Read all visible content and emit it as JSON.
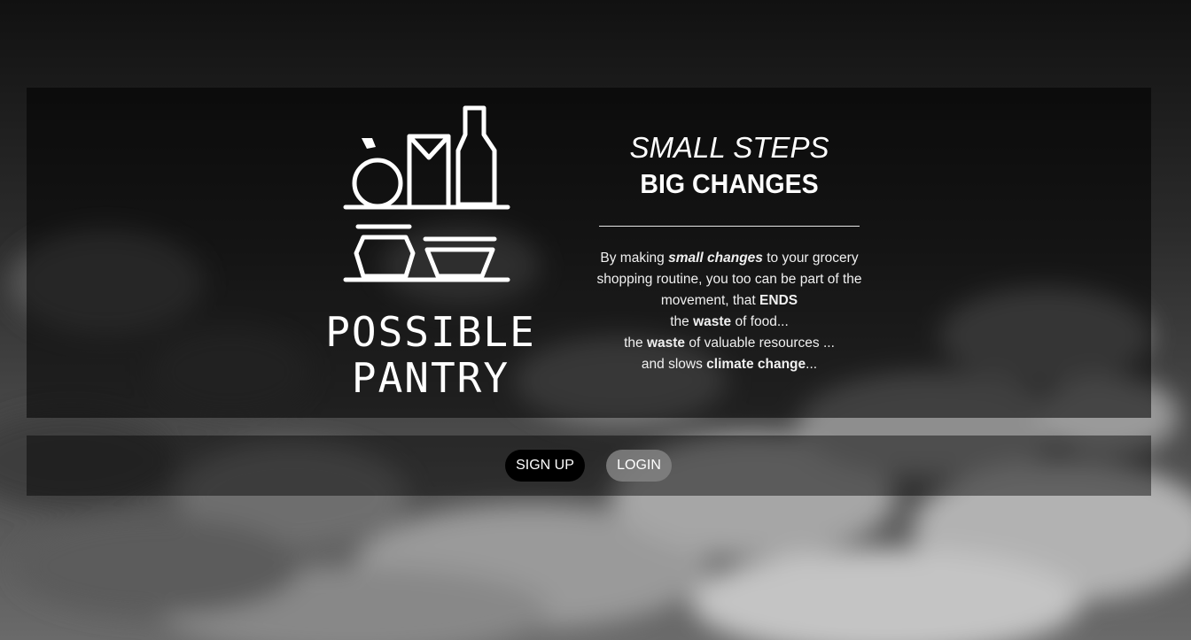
{
  "brand": {
    "line1": "POSSIBLE",
    "line2": "PANTRY",
    "logo_icon": "pantry-shelf-icon"
  },
  "tagline": {
    "line1": "SMALL STEPS",
    "line2": "BIG CHANGES"
  },
  "description": {
    "p1_pre": "By making ",
    "p1_em": "small changes",
    "p1_post": " to your grocery shopping routine, you too can be part of the movement, that ",
    "p1_strong": "ENDS",
    "p2_pre": "the ",
    "p2_strong": "waste",
    "p2_post": " of food...",
    "p3_pre": "the ",
    "p3_strong": "waste",
    "p3_post": " of valuable resources ...",
    "p4_pre": "and slows ",
    "p4_strong": "climate change",
    "p4_post": "..."
  },
  "actions": {
    "signup_label": "SIGN UP",
    "login_label": "LOGIN"
  },
  "colors": {
    "signup_bg": "#000000",
    "login_bg": "#828282",
    "text": "#ffffff"
  }
}
